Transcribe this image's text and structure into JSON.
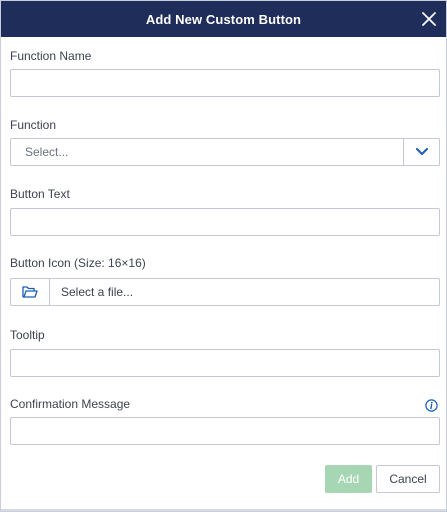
{
  "dialog": {
    "title": "Add New Custom Button",
    "close_icon": "close-icon"
  },
  "fields": {
    "function_name": {
      "label": "Function Name",
      "value": ""
    },
    "function": {
      "label": "Function",
      "placeholder": "Select...",
      "arrow_icon": "chevron-down-icon"
    },
    "button_text": {
      "label": "Button Text",
      "value": ""
    },
    "button_icon": {
      "label": "Button Icon (Size: 16×16)",
      "placeholder": "Select a file...",
      "folder_icon": "folder-open-icon"
    },
    "tooltip": {
      "label": "Tooltip",
      "value": ""
    },
    "confirmation_message": {
      "label": "Confirmation Message",
      "value": "",
      "info_icon": "info-icon"
    }
  },
  "actions": {
    "add_label": "Add",
    "cancel_label": "Cancel"
  },
  "colors": {
    "titlebar": "#1f2d5a",
    "accent": "#1a5fb4",
    "add_button_disabled": "#a6d6b4"
  }
}
